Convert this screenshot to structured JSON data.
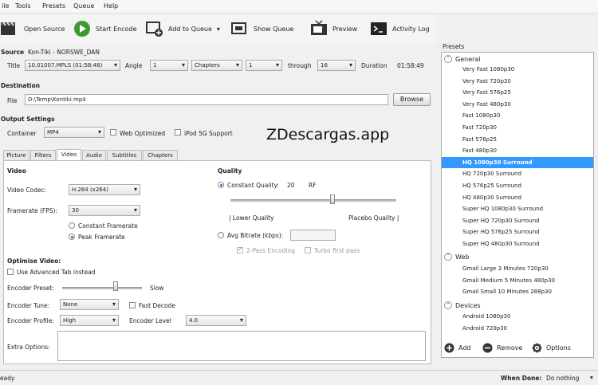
{
  "menu": [
    "ile",
    "Tools",
    "Presets",
    "Queue",
    "Help"
  ],
  "toolbar": {
    "open_source": "Open Source",
    "start_encode": "Start Encode",
    "add_to_queue": "Add to Queue",
    "show_queue": "Show Queue",
    "preview": "Preview",
    "activity_log": "Activity Log"
  },
  "source": {
    "label": "Source",
    "name": "Kon-Tiki - NORSWE_DAN",
    "title_label": "Title",
    "title_value": "10.01007.MPLS (01:58:48)",
    "angle_label": "Angle",
    "angle_value": "1",
    "chapters_value": "Chapters",
    "from_value": "1",
    "through_label": "through",
    "to_value": "16",
    "duration_label": "Duration",
    "duration_value": "01:58:49"
  },
  "destination": {
    "label": "Destination",
    "file_label": "File",
    "file_value": "D:\\Temp\\Kontiki.mp4",
    "browse": "Browse"
  },
  "output": {
    "label": "Output Settings",
    "container_label": "Container",
    "container_value": "MP4",
    "web_optimized": "Web Optimized",
    "ipod": "iPod 5G Support"
  },
  "watermark": "ZDescargas.app",
  "tabs": [
    "Picture",
    "Filters",
    "Video",
    "Audio",
    "Subtitles",
    "Chapters"
  ],
  "video": {
    "heading": "Video",
    "codec_label": "Video Codec:",
    "codec_value": "H.264 (x264)",
    "fps_label": "Framerate (FPS):",
    "fps_value": "30",
    "constant_fr": "Constant Framerate",
    "peak_fr": "Peak Framerate"
  },
  "quality": {
    "heading": "Quality",
    "cq_label": "Constant Quality:",
    "cq_value": "20",
    "rf": "RF",
    "lower": "| Lower Quality",
    "placebo": "Placebo Quality |",
    "avg_bitrate": "Avg Bitrate (kbps):",
    "two_pass": "2-Pass Encoding",
    "turbo": "Turbo first pass"
  },
  "optimise": {
    "heading": "Optimise Video:",
    "advanced": "Use Advanced Tab instead",
    "preset_label": "Encoder Preset:",
    "slow": "Slow",
    "tune_label": "Encoder Tune:",
    "tune_value": "None",
    "fast_decode": "Fast Decode",
    "profile_label": "Encoder Profile:",
    "profile_value": "High",
    "level_label": "Encoder Level",
    "level_value": "4.0",
    "extra_label": "Extra Options:"
  },
  "presets": {
    "label": "Presets",
    "groups": [
      {
        "name": "General",
        "items": [
          "Very Fast 1080p30",
          "Very Fast 720p30",
          "Very Fast 576p25",
          "Very Fast 480p30",
          "Fast 1080p30",
          "Fast 720p30",
          "Fast 576p25",
          "Fast 480p30",
          "HQ 1080p30 Surround",
          "HQ 720p30 Surround",
          "HQ 576p25 Surround",
          "HQ 480p30 Surround",
          "Super HQ 1080p30 Surround",
          "Super HQ 720p30 Surround",
          "Super HQ 576p25 Surround",
          "Super HQ 480p30 Surround"
        ]
      },
      {
        "name": "Web",
        "items": [
          "Gmail Large 3 Minutes 720p30",
          "Gmail Medium 5 Minutes 480p30",
          "Gmail Small 10 Minutes 288p30"
        ]
      },
      {
        "name": "Devices",
        "items": [
          "Android 1080p30",
          "Android 720p30"
        ]
      }
    ],
    "selected": "HQ 1080p30 Surround",
    "add": "Add",
    "remove": "Remove",
    "options": "Options"
  },
  "status": {
    "left": "eady",
    "when_done_label": "When Done:",
    "when_done_value": "Do nothing"
  }
}
